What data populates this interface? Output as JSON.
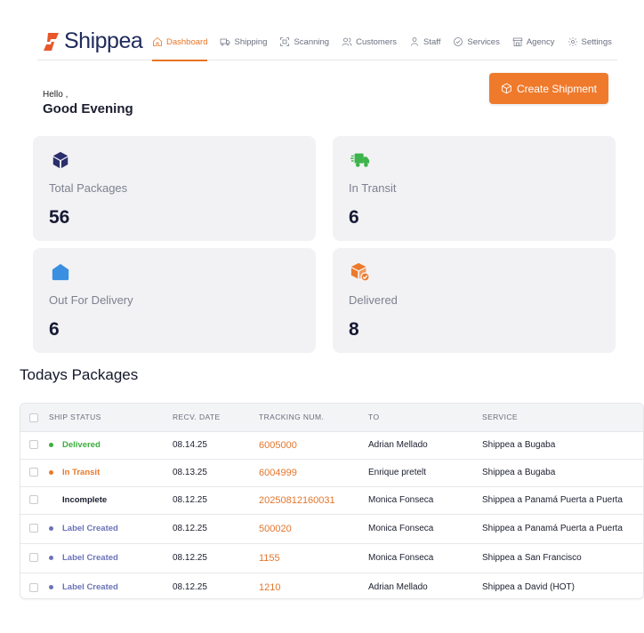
{
  "brand": {
    "name": "Shippea",
    "accent": "#e87425",
    "logo_color": "#1f2b5c"
  },
  "nav": [
    {
      "label": "Dashboard",
      "icon": "home-icon",
      "active": true
    },
    {
      "label": "Shipping",
      "icon": "truck-icon",
      "active": false
    },
    {
      "label": "Scanning",
      "icon": "scan-icon",
      "active": false
    },
    {
      "label": "Customers",
      "icon": "users-icon",
      "active": false
    },
    {
      "label": "Staff",
      "icon": "user-icon",
      "active": false
    },
    {
      "label": "Services",
      "icon": "check-circle-icon",
      "active": false
    },
    {
      "label": "Agency",
      "icon": "store-icon",
      "active": false
    },
    {
      "label": "Settings",
      "icon": "gear-icon",
      "active": false
    }
  ],
  "greeting": {
    "hello": "Hello ,",
    "message": "Good Evening"
  },
  "create_button": {
    "label": "Create Shipment",
    "icon": "package-plus-icon"
  },
  "stats": [
    {
      "label": "Total Packages",
      "value": "56",
      "icon": "box-icon",
      "icon_color": "#2a2f6b"
    },
    {
      "label": "In Transit",
      "value": "6",
      "icon": "delivery-truck-icon",
      "icon_color": "#3cb44b"
    },
    {
      "label": "Out For Delivery",
      "value": "6",
      "icon": "house-icon",
      "icon_color": "#3b8fe0"
    },
    {
      "label": "Delivered",
      "value": "8",
      "icon": "box-check-icon",
      "icon_color": "#ec7a2c"
    }
  ],
  "table": {
    "title": "Todays Packages",
    "columns": [
      "SHIP STATUS",
      "RECV. DATE",
      "TRACKING NUM.",
      "TO",
      "SERVICE"
    ],
    "rows": [
      {
        "status": "Delivered",
        "status_color": "#3cad3c",
        "dot": true,
        "date": "08.14.25",
        "tracking": "6005000",
        "to": "Adrian Mellado",
        "service": "Shippea a Bugaba"
      },
      {
        "status": "In Transit",
        "status_color": "#e8792c",
        "dot": true,
        "date": "08.13.25",
        "tracking": "6004999",
        "to": "Enrique pretelt",
        "service": "Shippea a Bugaba"
      },
      {
        "status": "Incomplete",
        "status_color": "#1b1e2e",
        "dot": false,
        "date": "08.12.25",
        "tracking": "20250812160031",
        "to": "Monica Fonseca",
        "service": "Shippea a Panamá Puerta a Puerta"
      },
      {
        "status": "Label Created",
        "status_color": "#6b73b8",
        "dot": true,
        "date": "08.12.25",
        "tracking": "500020",
        "to": "Monica Fonseca",
        "service": "Shippea a Panamá Puerta a Puerta"
      },
      {
        "status": "Label Created",
        "status_color": "#6b73b8",
        "dot": true,
        "date": "08.12.25",
        "tracking": "1155",
        "to": "Monica Fonseca",
        "service": "Shippea a San Francisco"
      },
      {
        "status": "Label Created",
        "status_color": "#6b73b8",
        "dot": true,
        "date": "08.12.25",
        "tracking": "1210",
        "to": "Adrian Mellado",
        "service": "Shippea a David (HOT)"
      }
    ]
  }
}
